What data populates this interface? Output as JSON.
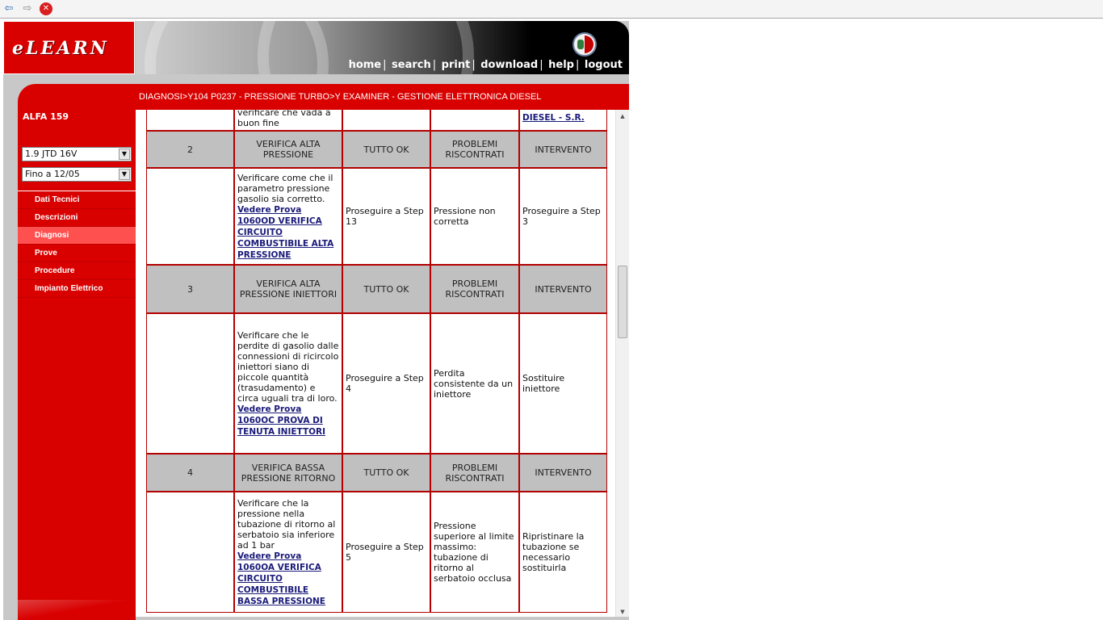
{
  "browser": {
    "back_icon": "back-arrow-icon",
    "forward_icon": "forward-arrow-icon",
    "stop_icon": "stop-icon"
  },
  "header": {
    "logo": "eLEARN",
    "nav": [
      "home",
      "search",
      "print",
      "download",
      "help",
      "logout"
    ]
  },
  "breadcrumb": "DIAGNOSI>Y104 P0237 - PRESSIONE TURBO>Y EXAMINER - GESTIONE ELETTRONICA DIESEL",
  "sidebar": {
    "model": "ALFA 159",
    "engine_select": "1.9 JTD 16V",
    "date_select": "Fino a 12/05",
    "menu": [
      {
        "label": "Dati Tecnici",
        "active": false
      },
      {
        "label": "Descrizioni",
        "active": false
      },
      {
        "label": "Diagnosi",
        "active": true
      },
      {
        "label": "Prove",
        "active": false
      },
      {
        "label": "Procedure",
        "active": false
      },
      {
        "label": "Impianto Elettrico",
        "active": false
      }
    ]
  },
  "table": {
    "partial_top": {
      "text": "verificare che vada a buon fine",
      "link": "DIESEL - S.R."
    },
    "steps": [
      {
        "step": "2",
        "title": "VERIFICA ALTA PRESSIONE",
        "ok_header": "TUTTO OK",
        "problem_header": "PROBLEMI RISCONTRATI",
        "action_header": "INTERVENTO",
        "description": "Verificare come che il parametro pressione gasolio sia corretto.",
        "link": " Vedere Prova 1060OD VERIFICA CIRCUITO COMBUSTIBILE ALTA PRESSIONE",
        "ok": "Proseguire a Step 13",
        "problem": "Pressione non corretta",
        "action": "Proseguire a Step 3"
      },
      {
        "step": "3",
        "title": "VERIFICA ALTA PRESSIONE INIETTORI",
        "ok_header": "TUTTO OK",
        "problem_header": "PROBLEMI RISCONTRATI",
        "action_header": "INTERVENTO",
        "description": "Verificare che le perdite di gasolio dalle connessioni di ricircolo iniettori siano di piccole quantità (trasudamento) e circa uguali tra di loro.",
        "link": " Vedere Prova 1060OC PROVA DI TENUTA INIETTORI",
        "ok": "Proseguire a Step 4",
        "problem": "Perdita consistente da un iniettore",
        "action": "Sostituire iniettore"
      },
      {
        "step": "4",
        "title": "VERIFICA BASSA PRESSIONE RITORNO",
        "ok_header": "TUTTO OK",
        "problem_header": "PROBLEMI RISCONTRATI",
        "action_header": "INTERVENTO",
        "description": "Verificare che la pressione nella tubazione di ritorno al serbatoio sia inferiore ad 1 bar",
        "link": " Vedere Prova 1060OA VERIFICA CIRCUITO COMBUSTIBILE BASSA PRESSIONE",
        "ok": "Proseguire a Step 5",
        "problem": "Pressione superiore al limite massimo: tubazione di ritorno al serbatoio occlusa",
        "action": "Ripristinare la tubazione se necessario sostituirla"
      }
    ]
  },
  "scrollbar": {
    "position_fraction": 0.3
  },
  "colors": {
    "brand_red": "#d90000",
    "header_gray": "#c0c0c0",
    "active_menu": "#ff5050"
  }
}
